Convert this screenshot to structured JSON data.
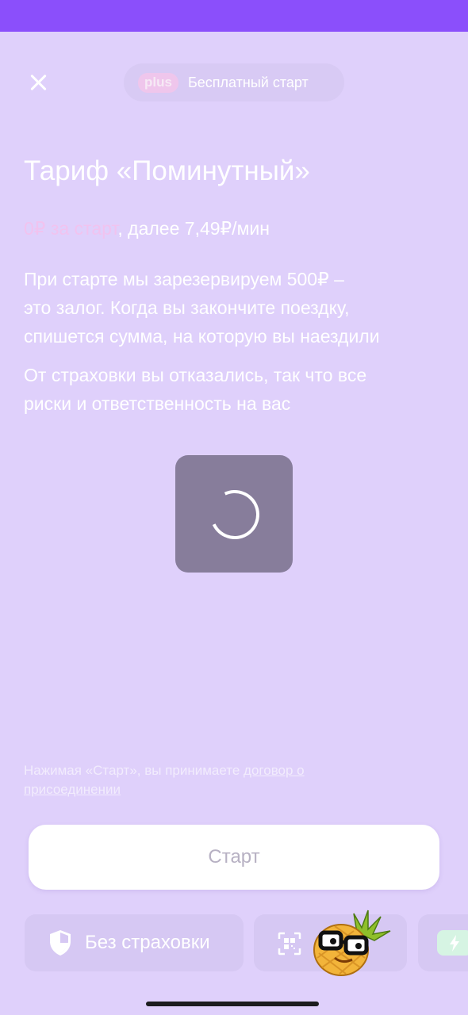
{
  "header": {
    "plus_badge": "plus",
    "promo_text": "Бесплатный старт"
  },
  "tariff": {
    "title": "Тариф «Поминутный»",
    "price_start": "0₽ за старт",
    "price_rest": ", далее 7,49₽/мин"
  },
  "info": {
    "deposit_lines": [
      "При старте мы зарезервируем 500₽ –",
      "это залог. Когда вы закончите поездку,",
      "спишется сумма, на которую вы наездили"
    ],
    "insurance_lines": [
      "От страховки вы отказались, так что все",
      "риски и ответственность на вас"
    ]
  },
  "consent": {
    "prefix": "Нажимая «Старт», вы принимаете ",
    "link": "договор о присоединении"
  },
  "actions": {
    "start_label": "Старт"
  },
  "options": {
    "insurance_label": "Без страховки"
  },
  "colors": {
    "status_bar": "#8b4ffb",
    "background": "#dfd0fb",
    "accent_pink": "#f1c3ef",
    "loader": "#877d9b"
  },
  "icons": [
    "close-icon",
    "shield-icon",
    "qr-scan-icon",
    "bolt-icon",
    "loading-spinner-icon",
    "pineapple-mascot-icon"
  ]
}
